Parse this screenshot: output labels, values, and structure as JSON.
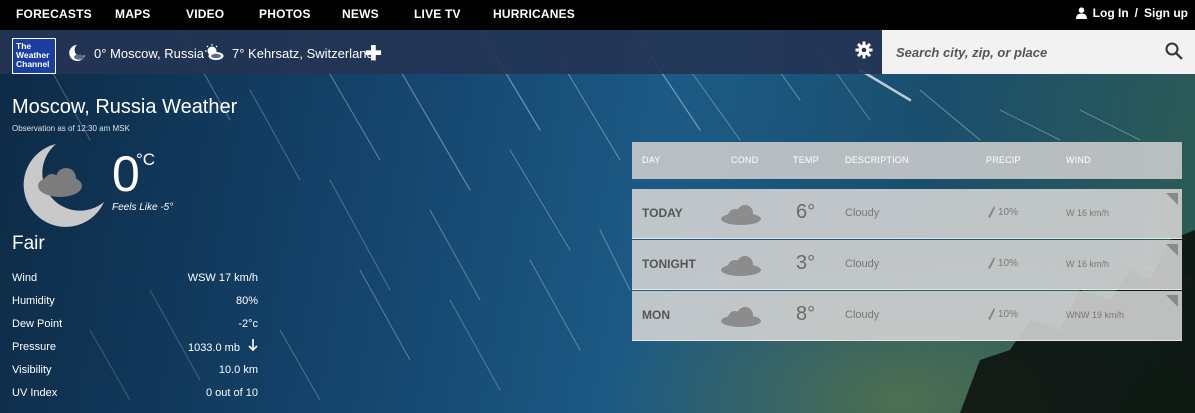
{
  "nav": {
    "items": [
      "FORECASTS",
      "MAPS",
      "VIDEO",
      "PHOTOS",
      "NEWS",
      "LIVE TV",
      "HURRICANES"
    ],
    "login": "Log In",
    "separator": "/",
    "signup": "Sign up"
  },
  "logo": {
    "line1": "The",
    "line2": "Weather",
    "line3": "Channel",
    "color": "#1b3ea3"
  },
  "locations": [
    {
      "text": "0° Moscow, Russia",
      "icon": "moon-cloud-icon"
    },
    {
      "text": "7° Kehrsatz, Switzerland",
      "icon": "sun-cloud-icon"
    }
  ],
  "search": {
    "placeholder": "Search city, zip, or place"
  },
  "current": {
    "title": "Moscow, Russia Weather",
    "observation": "Observation as of 12:30 am MSK",
    "temp": "0",
    "unit": "°C",
    "feels_like": "Feels Like -5°",
    "condition": "Fair",
    "details": [
      {
        "label": "Wind",
        "value": "WSW 17 km/h"
      },
      {
        "label": "Humidity",
        "value": "80%"
      },
      {
        "label": "Dew Point",
        "value": "-2°c"
      },
      {
        "label": "Pressure",
        "value": "1033.0 mb"
      },
      {
        "label": "Visibility",
        "value": "10.0 km"
      },
      {
        "label": "UV Index",
        "value": "0 out of 10"
      }
    ]
  },
  "forecast": {
    "headers": {
      "day": "DAY",
      "cond": "COND",
      "temp": "TEMP",
      "description": "DESCRIPTION",
      "precip": "PRECIP",
      "wind": "WIND"
    },
    "rows": [
      {
        "day": "TODAY",
        "temp": "6°",
        "description": "Cloudy",
        "precip": "10%",
        "wind": "W 16 km/h"
      },
      {
        "day": "TONIGHT",
        "temp": "3°",
        "description": "Cloudy",
        "precip": "10%",
        "wind": "W 16 km/h"
      },
      {
        "day": "MON",
        "temp": "8°",
        "description": "Cloudy",
        "precip": "10%",
        "wind": "WNW 19 km/h"
      }
    ]
  }
}
